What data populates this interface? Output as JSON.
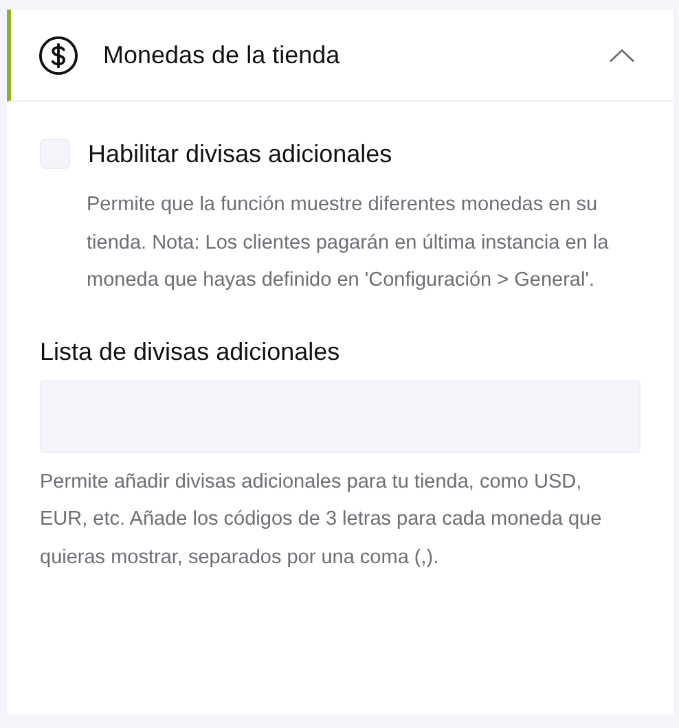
{
  "section": {
    "title": "Monedas de la tienda",
    "expanded": true
  },
  "enable_option": {
    "label": "Habilitar divisas adicionales",
    "checked": false,
    "description": "Permite que la función muestre diferentes monedas en su tienda. Nota: Los clientes pagarán en última instancia en la moneda que hayas definido en 'Configuración > General'."
  },
  "currency_list": {
    "label": "Lista de divisas adicionales",
    "help": "Permite añadir divisas adicionales para tu tienda, como USD, EUR, etc. Añade los códigos de 3 letras para cada moneda que quieras mostrar, separados por una coma (,)."
  }
}
